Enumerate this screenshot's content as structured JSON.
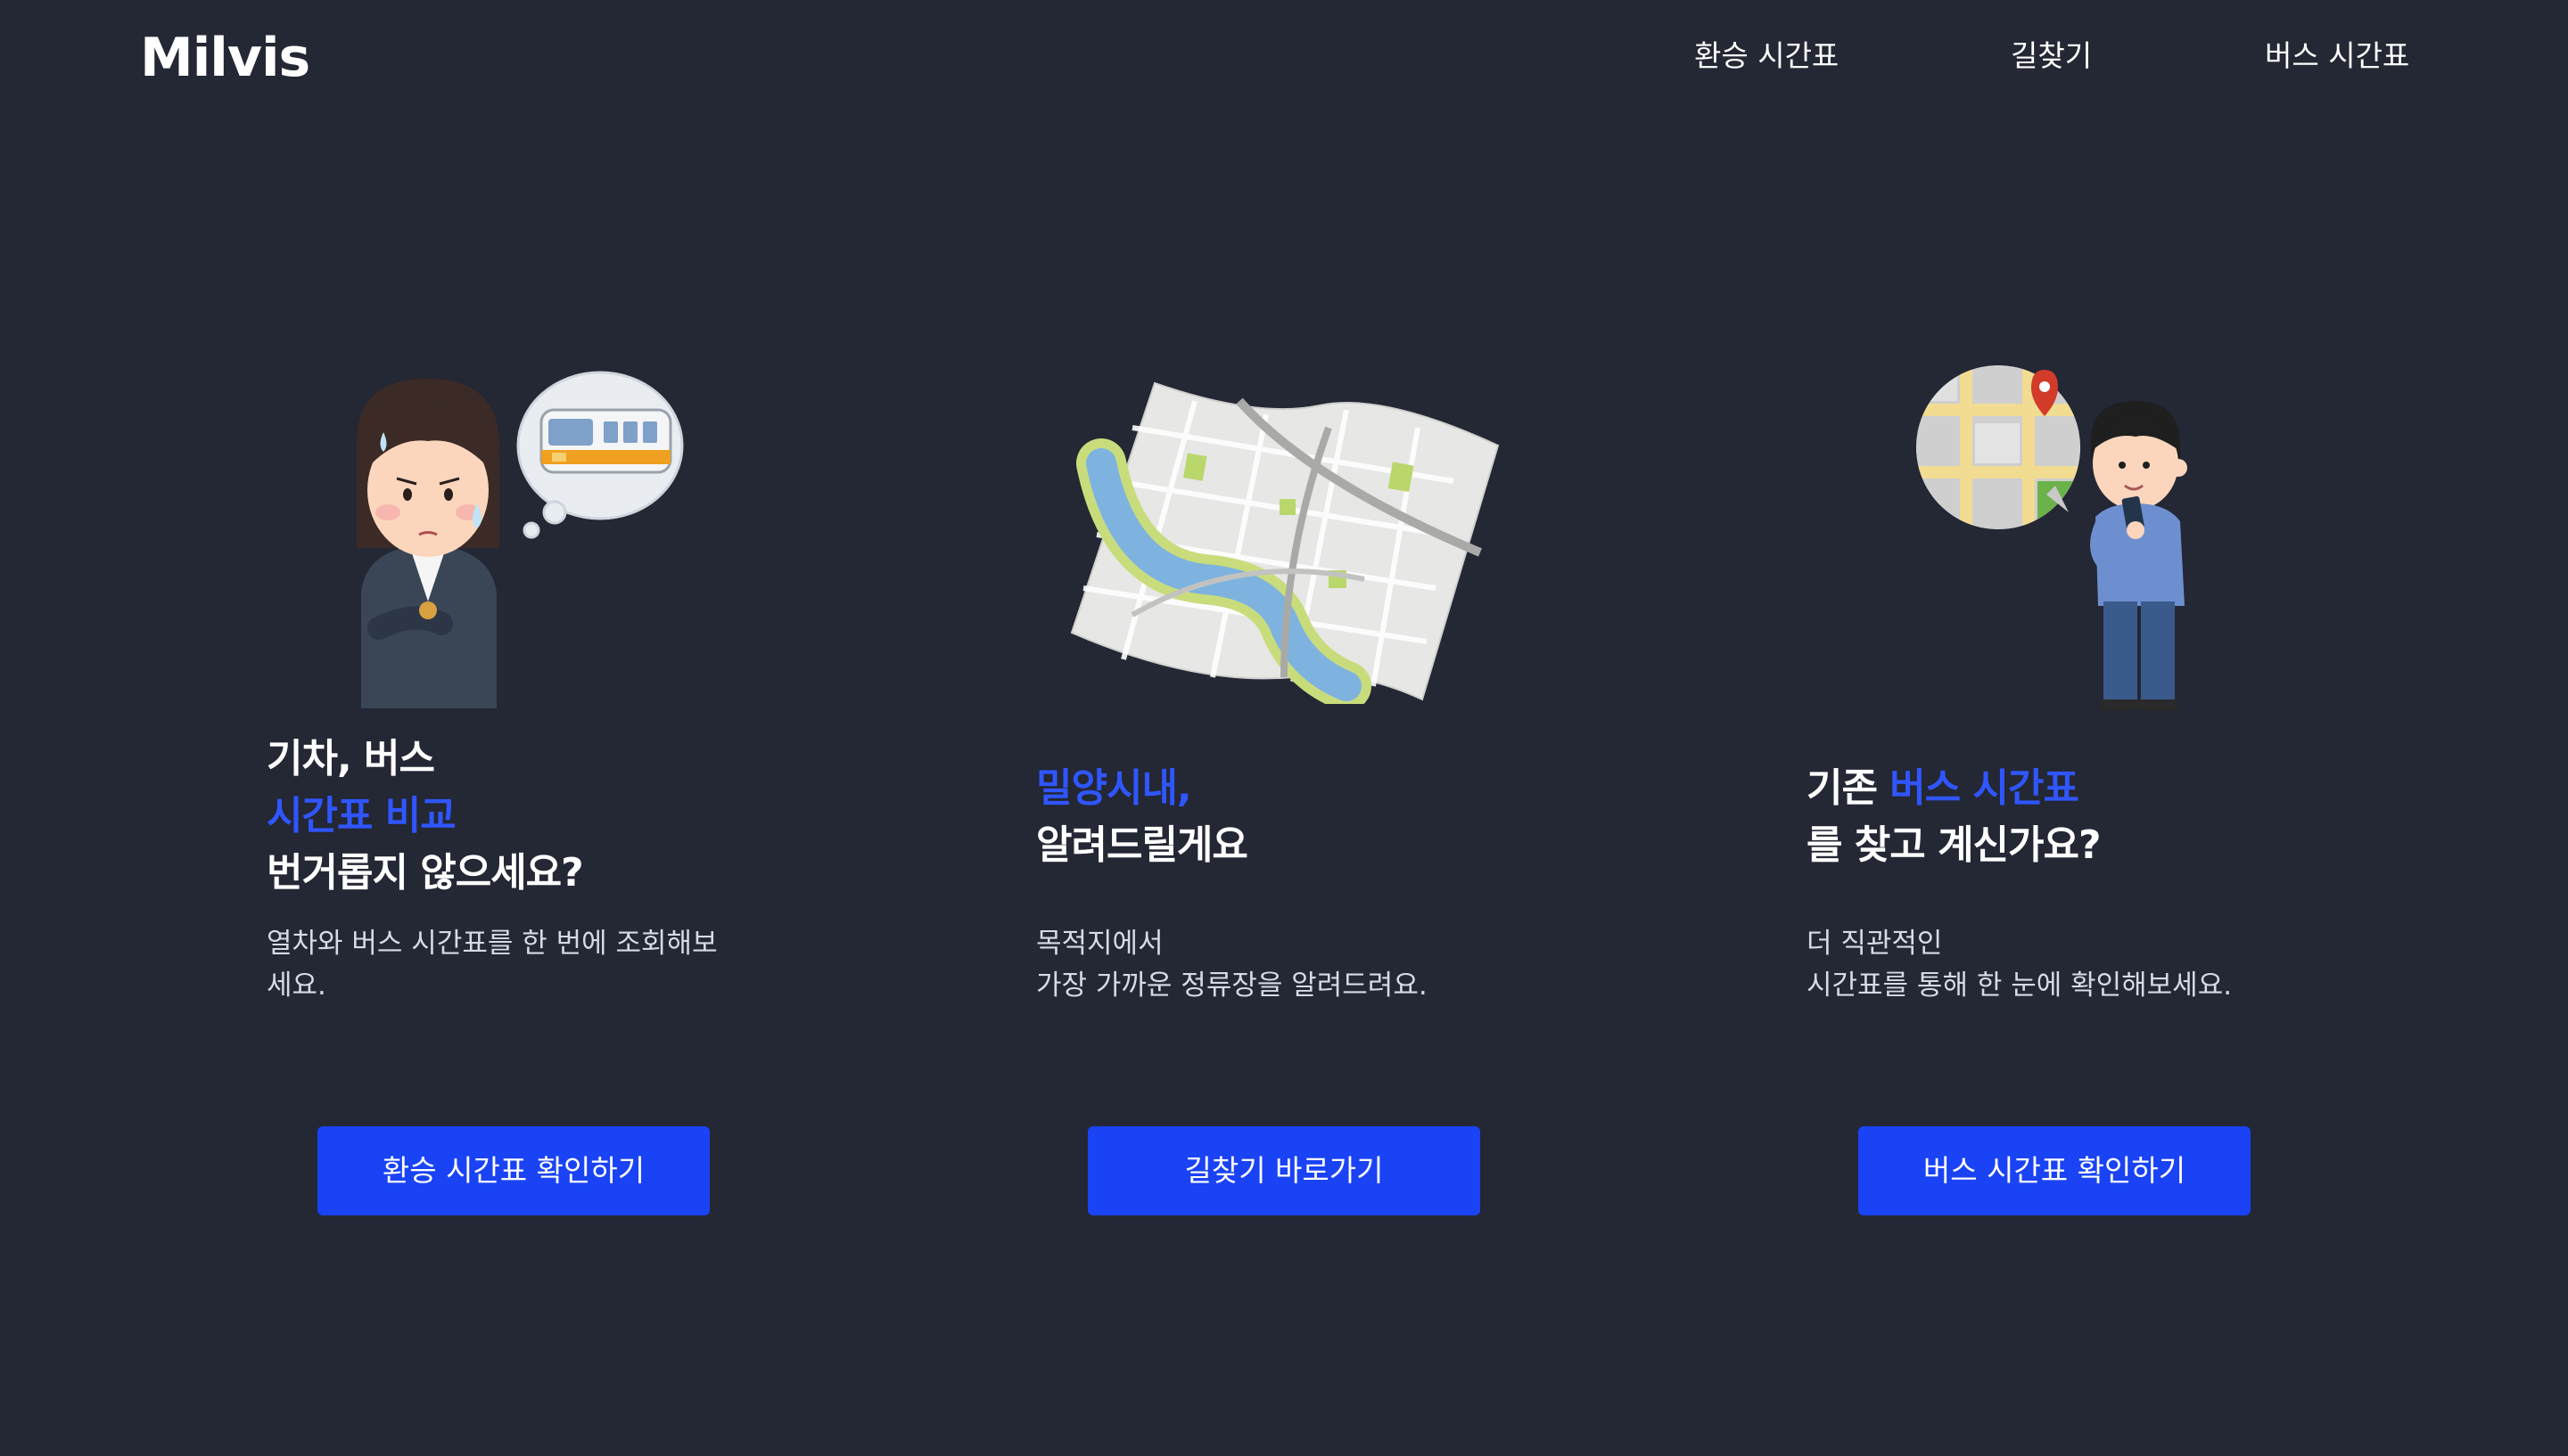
{
  "header": {
    "logo": "Milvis",
    "nav": [
      {
        "label": "환승 시간표"
      },
      {
        "label": "길찾기"
      },
      {
        "label": "버스 시간표"
      }
    ]
  },
  "cards": [
    {
      "illustration": "worried-commuter-train-illustration",
      "headline_lines": [
        {
          "parts": [
            {
              "text": "기차, 버스",
              "color": "white"
            }
          ]
        },
        {
          "parts": [
            {
              "text": "시간표 비교",
              "color": "blue"
            }
          ]
        },
        {
          "parts": [
            {
              "text": "번거롭지 않으세요?",
              "color": "white"
            }
          ]
        }
      ],
      "description_lines": [
        "열차와 버스 시간표를 한 번에 조회해보",
        "세요."
      ],
      "button_label": "환승 시간표 확인하기"
    },
    {
      "illustration": "city-map-illustration",
      "headline_lines": [
        {
          "parts": [
            {
              "text": "밀양시내,",
              "color": "blue"
            }
          ]
        },
        {
          "parts": [
            {
              "text": "알려드릴게요",
              "color": "white"
            }
          ]
        }
      ],
      "description_lines": [
        "목적지에서",
        "가장 가까운 정류장을 알려드려요."
      ],
      "button_label": "길찾기 바로가기"
    },
    {
      "illustration": "person-with-phone-map-illustration",
      "headline_lines": [
        {
          "parts": [
            {
              "text": "기존 ",
              "color": "white"
            },
            {
              "text": "버스 시간표",
              "color": "blue"
            }
          ]
        },
        {
          "parts": [
            {
              "text": "를 찾고 계신가요?",
              "color": "white"
            }
          ]
        }
      ],
      "description_lines": [
        "더 직관적인",
        "시간표를 통해 한 눈에 확인해보세요."
      ],
      "button_label": "버스 시간표 확인하기"
    }
  ],
  "colors": {
    "background": "#242734",
    "accent_blue": "#2f56ff",
    "button_blue": "#1a43f5",
    "text_white": "#ffffff",
    "text_muted": "#d8dbe4"
  }
}
